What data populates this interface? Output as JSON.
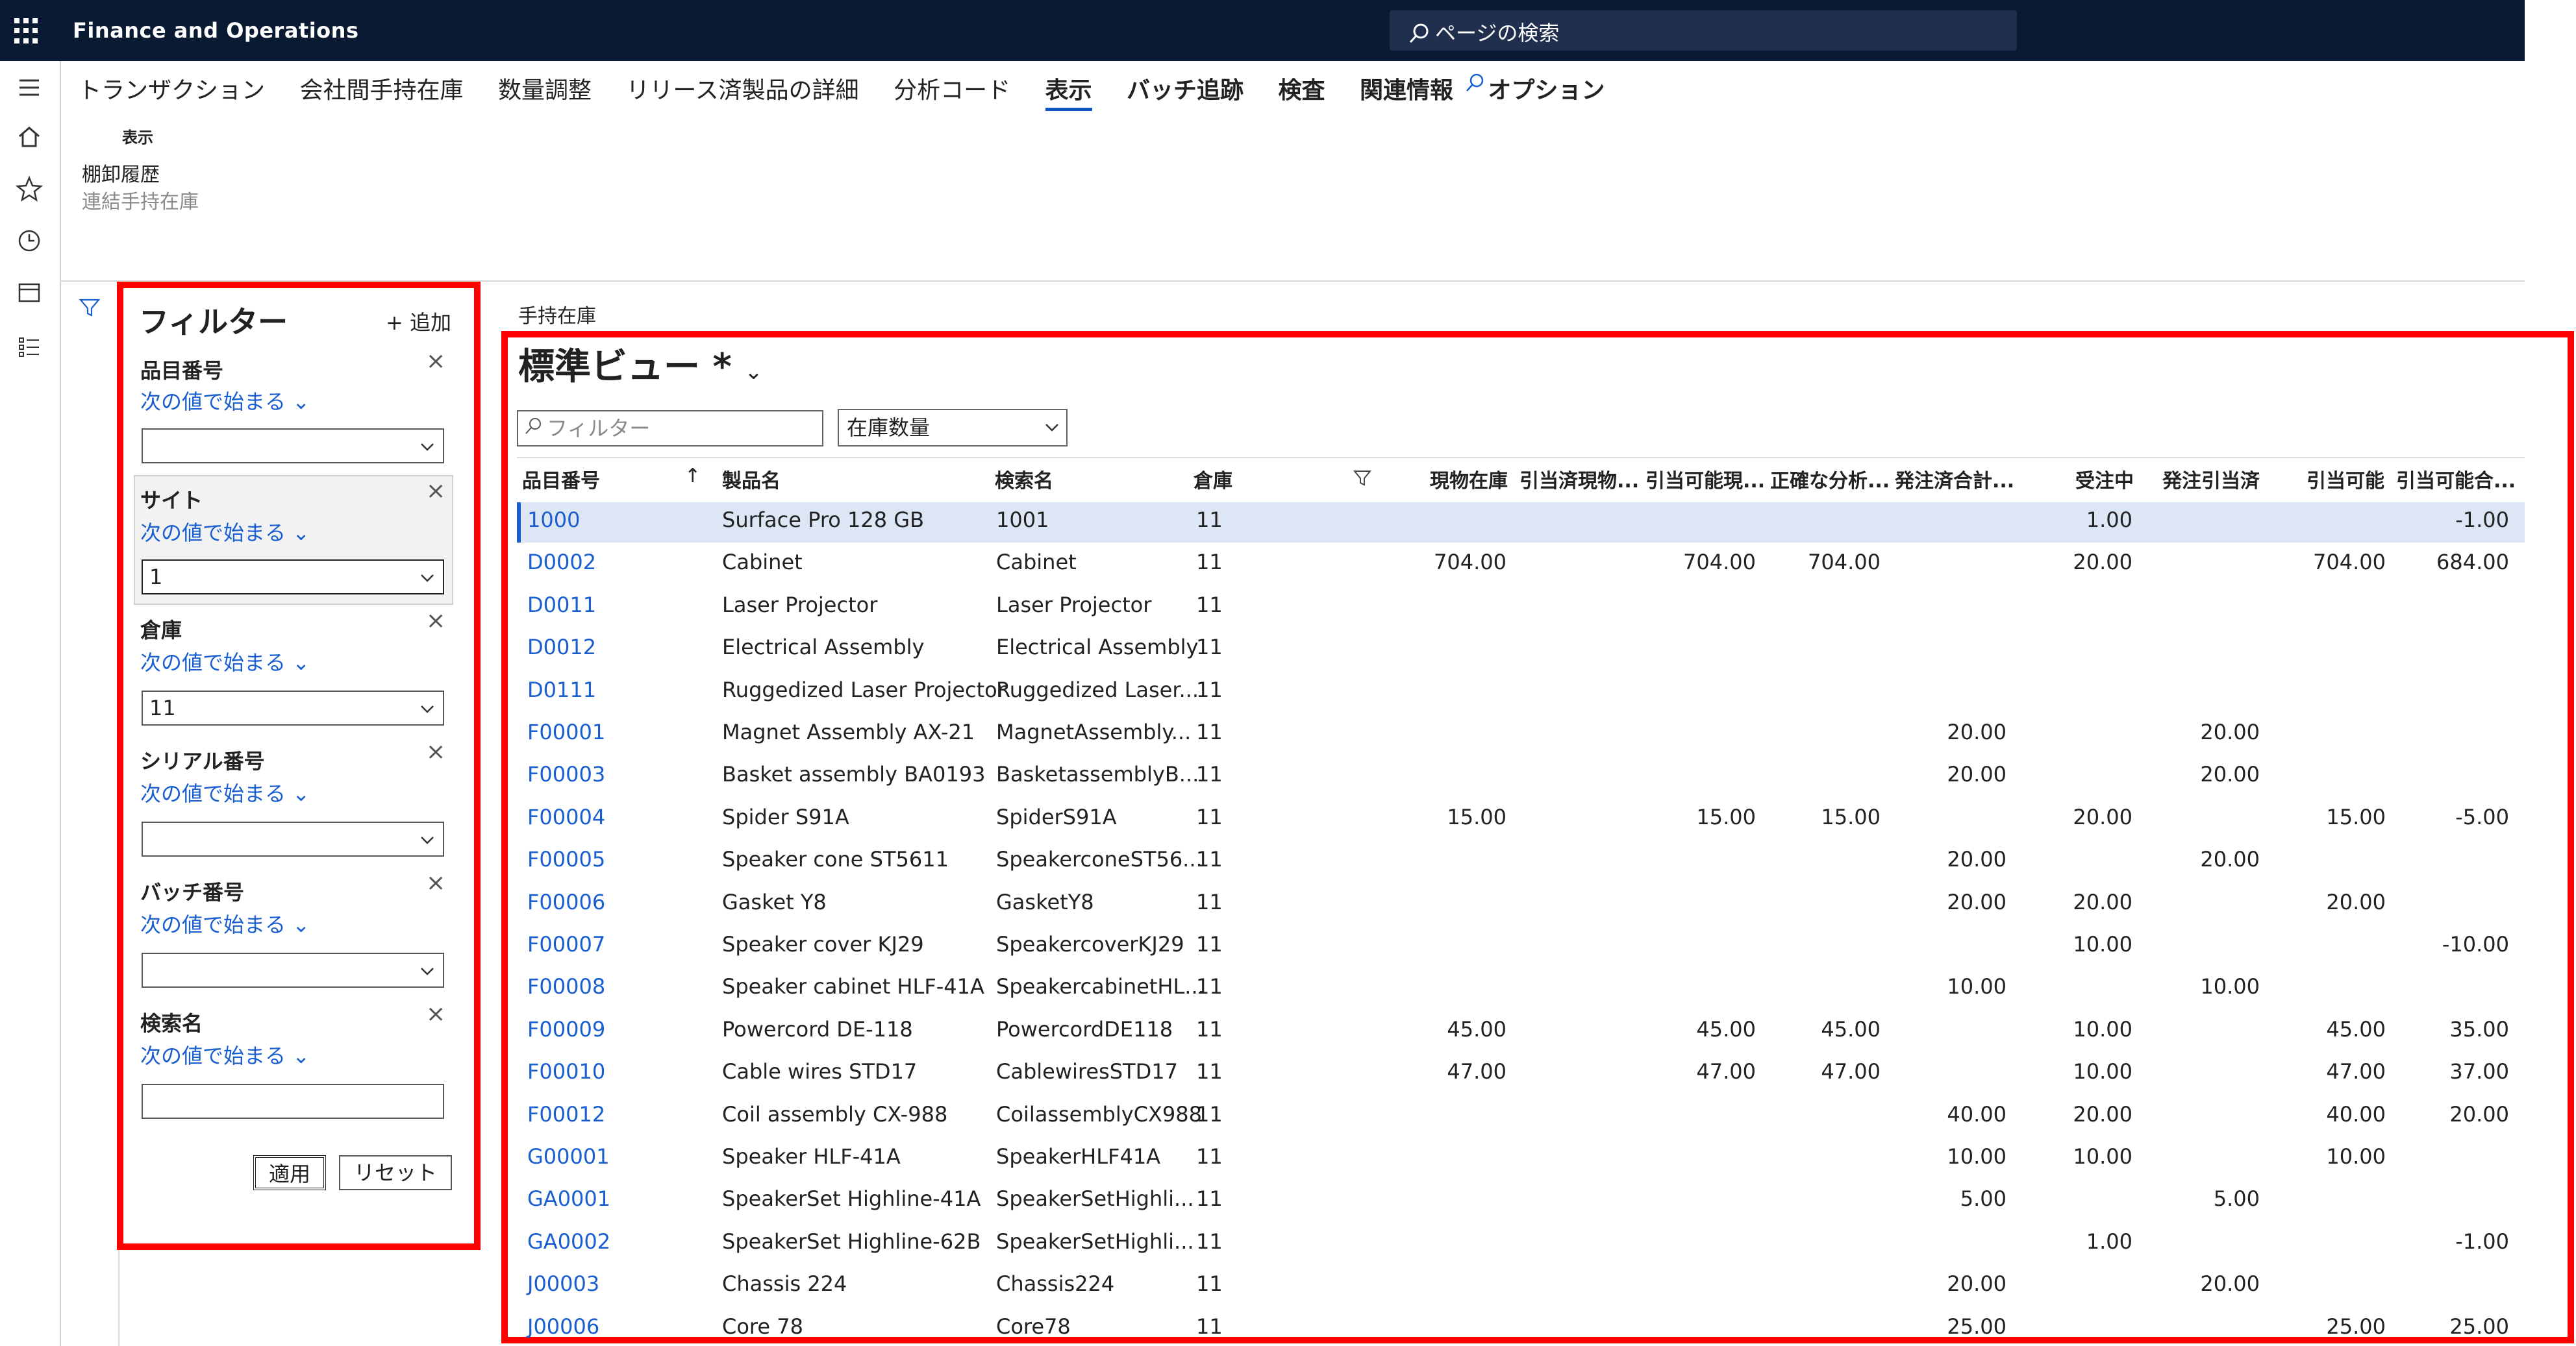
{
  "app": {
    "title": "Finance and Operations",
    "search_placeholder": "ページの検索"
  },
  "actionbar": {
    "tabs": [
      "トランザクション",
      "会社間手持在庫",
      "数量調整",
      "リリース済製品の詳細",
      "分析コード",
      "表示",
      "バッチ追跡",
      "検査",
      "関連情報",
      "オプション"
    ],
    "active_tab": "表示"
  },
  "ribbon": {
    "group_title": "表示",
    "items": [
      "棚卸履歴",
      "連結手持在庫"
    ]
  },
  "filter_pane": {
    "title": "フィルター",
    "add_label": "+ 追加",
    "operator": "次の値で始まる",
    "fields": [
      {
        "label": "品目番号",
        "value": ""
      },
      {
        "label": "サイト",
        "value": "1"
      },
      {
        "label": "倉庫",
        "value": "11"
      },
      {
        "label": "シリアル番号",
        "value": ""
      },
      {
        "label": "バッチ番号",
        "value": ""
      },
      {
        "label": "検索名",
        "value": ""
      }
    ],
    "apply_label": "適用",
    "reset_label": "リセット"
  },
  "grid": {
    "section_title": "手持在庫",
    "view_title": "標準ビュー *",
    "filter_placeholder": "フィルター",
    "dimension_select": "在庫数量",
    "columns": [
      "品目番号",
      "製品名",
      "検索名",
      "倉庫",
      "現物在庫",
      "引当済現物...",
      "引当可能現...",
      "正確な分析...",
      "発注済合計...",
      "受注中",
      "発注引当済",
      "引当可能",
      "引当可能合..."
    ],
    "rows": [
      [
        "1000",
        "Surface Pro 128 GB",
        "1001",
        "11",
        "",
        "",
        "",
        "",
        "",
        "1.00",
        "",
        "",
        "-1.00"
      ],
      [
        "D0002",
        "Cabinet",
        "Cabinet",
        "11",
        "704.00",
        "",
        "704.00",
        "704.00",
        "",
        "20.00",
        "",
        "704.00",
        "684.00"
      ],
      [
        "D0011",
        "Laser Projector",
        "Laser Projector",
        "11",
        "",
        "",
        "",
        "",
        "",
        "",
        "",
        "",
        ""
      ],
      [
        "D0012",
        "Electrical Assembly",
        "Electrical Assembly",
        "11",
        "",
        "",
        "",
        "",
        "",
        "",
        "",
        "",
        ""
      ],
      [
        "D0111",
        "Ruggedized Laser Projector",
        "Ruggedized Laser...",
        "11",
        "",
        "",
        "",
        "",
        "",
        "",
        "",
        "",
        ""
      ],
      [
        "F00001",
        "Magnet Assembly AX-21",
        "MagnetAssembly...",
        "11",
        "",
        "",
        "",
        "",
        "20.00",
        "",
        "20.00",
        "",
        ""
      ],
      [
        "F00003",
        "Basket assembly BA0193",
        "BasketassemblyB...",
        "11",
        "",
        "",
        "",
        "",
        "20.00",
        "",
        "20.00",
        "",
        ""
      ],
      [
        "F00004",
        "Spider S91A",
        "SpiderS91A",
        "11",
        "15.00",
        "",
        "15.00",
        "15.00",
        "",
        "20.00",
        "",
        "15.00",
        "-5.00"
      ],
      [
        "F00005",
        "Speaker cone ST5611",
        "SpeakerconeST56...",
        "11",
        "",
        "",
        "",
        "",
        "20.00",
        "",
        "20.00",
        "",
        ""
      ],
      [
        "F00006",
        "Gasket Y8",
        "GasketY8",
        "11",
        "",
        "",
        "",
        "",
        "20.00",
        "20.00",
        "",
        "20.00",
        ""
      ],
      [
        "F00007",
        "Speaker cover KJ29",
        "SpeakercoverKJ29",
        "11",
        "",
        "",
        "",
        "",
        "",
        "10.00",
        "",
        "",
        "-10.00"
      ],
      [
        "F00008",
        "Speaker cabinet HLF-41A",
        "SpeakercabinetHL...",
        "11",
        "",
        "",
        "",
        "",
        "10.00",
        "",
        "10.00",
        "",
        ""
      ],
      [
        "F00009",
        "Powercord DE-118",
        "PowercordDE118",
        "11",
        "45.00",
        "",
        "45.00",
        "45.00",
        "",
        "10.00",
        "",
        "45.00",
        "35.00"
      ],
      [
        "F00010",
        "Cable wires STD17",
        "CablewiresSTD17",
        "11",
        "47.00",
        "",
        "47.00",
        "47.00",
        "",
        "10.00",
        "",
        "47.00",
        "37.00"
      ],
      [
        "F00012",
        "Coil assembly CX-988",
        "CoilassemblyCX988",
        "11",
        "",
        "",
        "",
        "",
        "40.00",
        "20.00",
        "",
        "40.00",
        "20.00"
      ],
      [
        "G00001",
        "Speaker HLF-41A",
        "SpeakerHLF41A",
        "11",
        "",
        "",
        "",
        "",
        "10.00",
        "10.00",
        "",
        "10.00",
        ""
      ],
      [
        "GA0001",
        "SpeakerSet Highline-41A",
        "SpeakerSetHighli...",
        "11",
        "",
        "",
        "",
        "",
        "5.00",
        "",
        "5.00",
        "",
        ""
      ],
      [
        "GA0002",
        "SpeakerSet Highline-62B",
        "SpeakerSetHighli...",
        "11",
        "",
        "",
        "",
        "",
        "",
        "1.00",
        "",
        "",
        "-1.00"
      ],
      [
        "J00003",
        "Chassis 224",
        "Chassis224",
        "11",
        "",
        "",
        "",
        "",
        "20.00",
        "",
        "20.00",
        "",
        ""
      ],
      [
        "J00006",
        "Core 78",
        "Core78",
        "11",
        "",
        "",
        "",
        "",
        "25.00",
        "",
        "",
        "25.00",
        "25.00"
      ]
    ]
  }
}
